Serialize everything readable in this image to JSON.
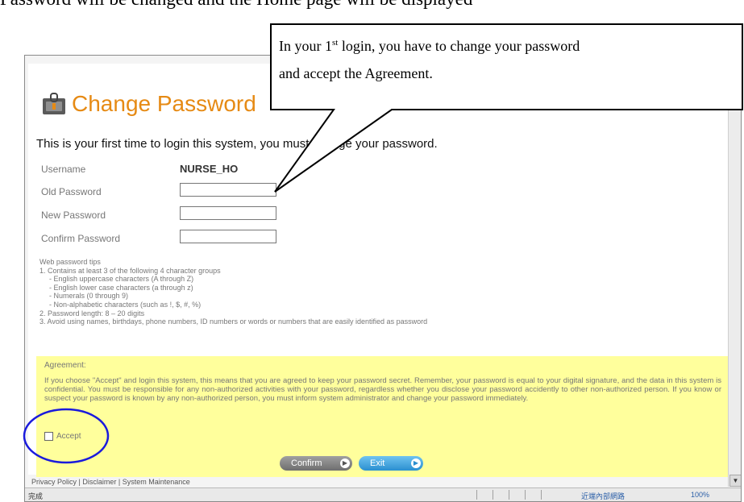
{
  "document_header": "Password will be changed and the Home page will be displayed",
  "callout": {
    "line1_prefix": "In your 1",
    "line1_sup": "st",
    "line1_suffix": " login, you have to change your password",
    "line2": "and accept the Agreement."
  },
  "page": {
    "title": "Change Password",
    "intro": "This is your first time to login this system, you must change your password."
  },
  "form": {
    "username_label": "Username",
    "username_value": "NURSE_HO",
    "old_password_label": "Old Password",
    "new_password_label": "New Password",
    "confirm_password_label": "Confirm Password"
  },
  "tips": {
    "heading": "Web password tips",
    "line1": "1. Contains at least 3 of the following 4 character groups",
    "line1a": "- English uppercase characters (A through Z)",
    "line1b": "- English lower case characters (a through z)",
    "line1c": "- Numerals (0 through 9)",
    "line1d": "- Non-alphabetic characters (such as !, $, #, %)",
    "line2": "2. Password length: 8 – 20 digits",
    "line3": "3. Avoid using names, birthdays, phone numbers, ID numbers or words or numbers that are easily identified as password"
  },
  "agreement": {
    "title": "Agreement:",
    "text": "If you choose \"Accept\" and login this system, this means that you are agreed to keep your password secret. Remember, your password is equal to your digital signature, and the data in this system is confidential. You must be responsible for any non-authorized activities with your password, regardless whether you disclose your password accidently to other non-authorized person. If you know or suspect your password is known by any non-authorized person, you must inform system administrator and change your password immediately.",
    "accept_label": "Accept",
    "accept_checked": false
  },
  "buttons": {
    "confirm": "Confirm",
    "exit": "Exit"
  },
  "footer": {
    "text": "Privacy Policy | Disclaimer | System Maintenance"
  },
  "statusbar": {
    "left": "完成",
    "zone": "近端內部網路",
    "zoom": "100%"
  },
  "colors": {
    "title_orange": "#e68a14",
    "agreement_bg": "#ffff9c",
    "exit_blue": "#2b8fcf",
    "highlight_circle": "#1a1adc"
  }
}
